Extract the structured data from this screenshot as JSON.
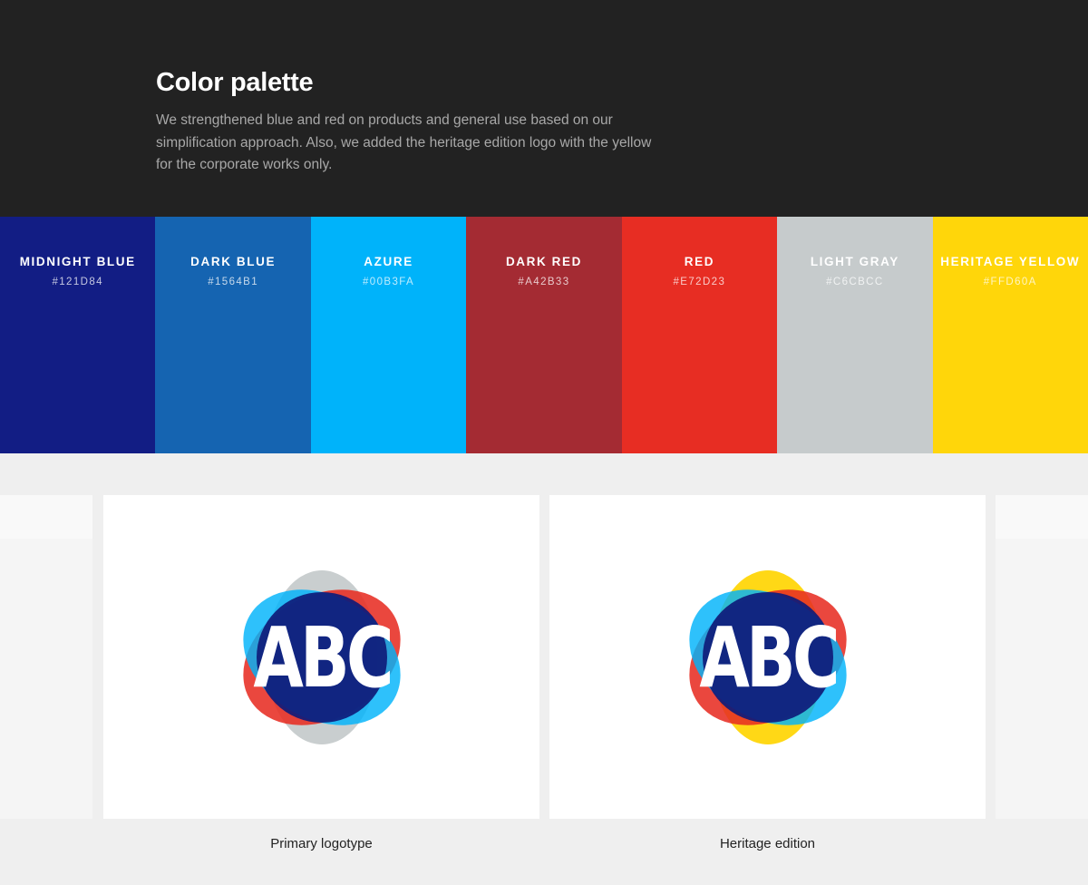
{
  "header": {
    "title": "Color palette",
    "description": "We strengthened blue and red on products and general use based on our simplification approach. Also, we added the heritage edition logo with the yellow for the corporate works only."
  },
  "palette": [
    {
      "name": "MIDNIGHT BLUE",
      "hex": "#121D84",
      "text_color": "#ffffff"
    },
    {
      "name": "DARK BLUE",
      "hex": "#1564B1",
      "text_color": "#ffffff"
    },
    {
      "name": "AZURE",
      "hex": "#00B3FA",
      "text_color": "#ffffff"
    },
    {
      "name": "DARK RED",
      "hex": "#A42B33",
      "text_color": "#ffffff"
    },
    {
      "name": "RED",
      "hex": "#E72D23",
      "text_color": "#ffffff"
    },
    {
      "name": "LIGHT GRAY",
      "hex": "#C6CBCC",
      "text_color": "#ffffff"
    },
    {
      "name": "HERITAGE YELLOW",
      "hex": "#FFD60A",
      "text_color": "#ffffff"
    }
  ],
  "logos": [
    {
      "caption": "Primary logotype",
      "mark_text": "ABC",
      "accent_color": "#C6CBCC"
    },
    {
      "caption": "Heritage edition",
      "mark_text": "ABC",
      "accent_color": "#FFD60A"
    }
  ],
  "logo_colors": {
    "red": "#E72D23",
    "azure": "#00B3FA",
    "dark_blue": "#1564B1",
    "midnight": "#0F1B7A",
    "text": "#ffffff"
  }
}
